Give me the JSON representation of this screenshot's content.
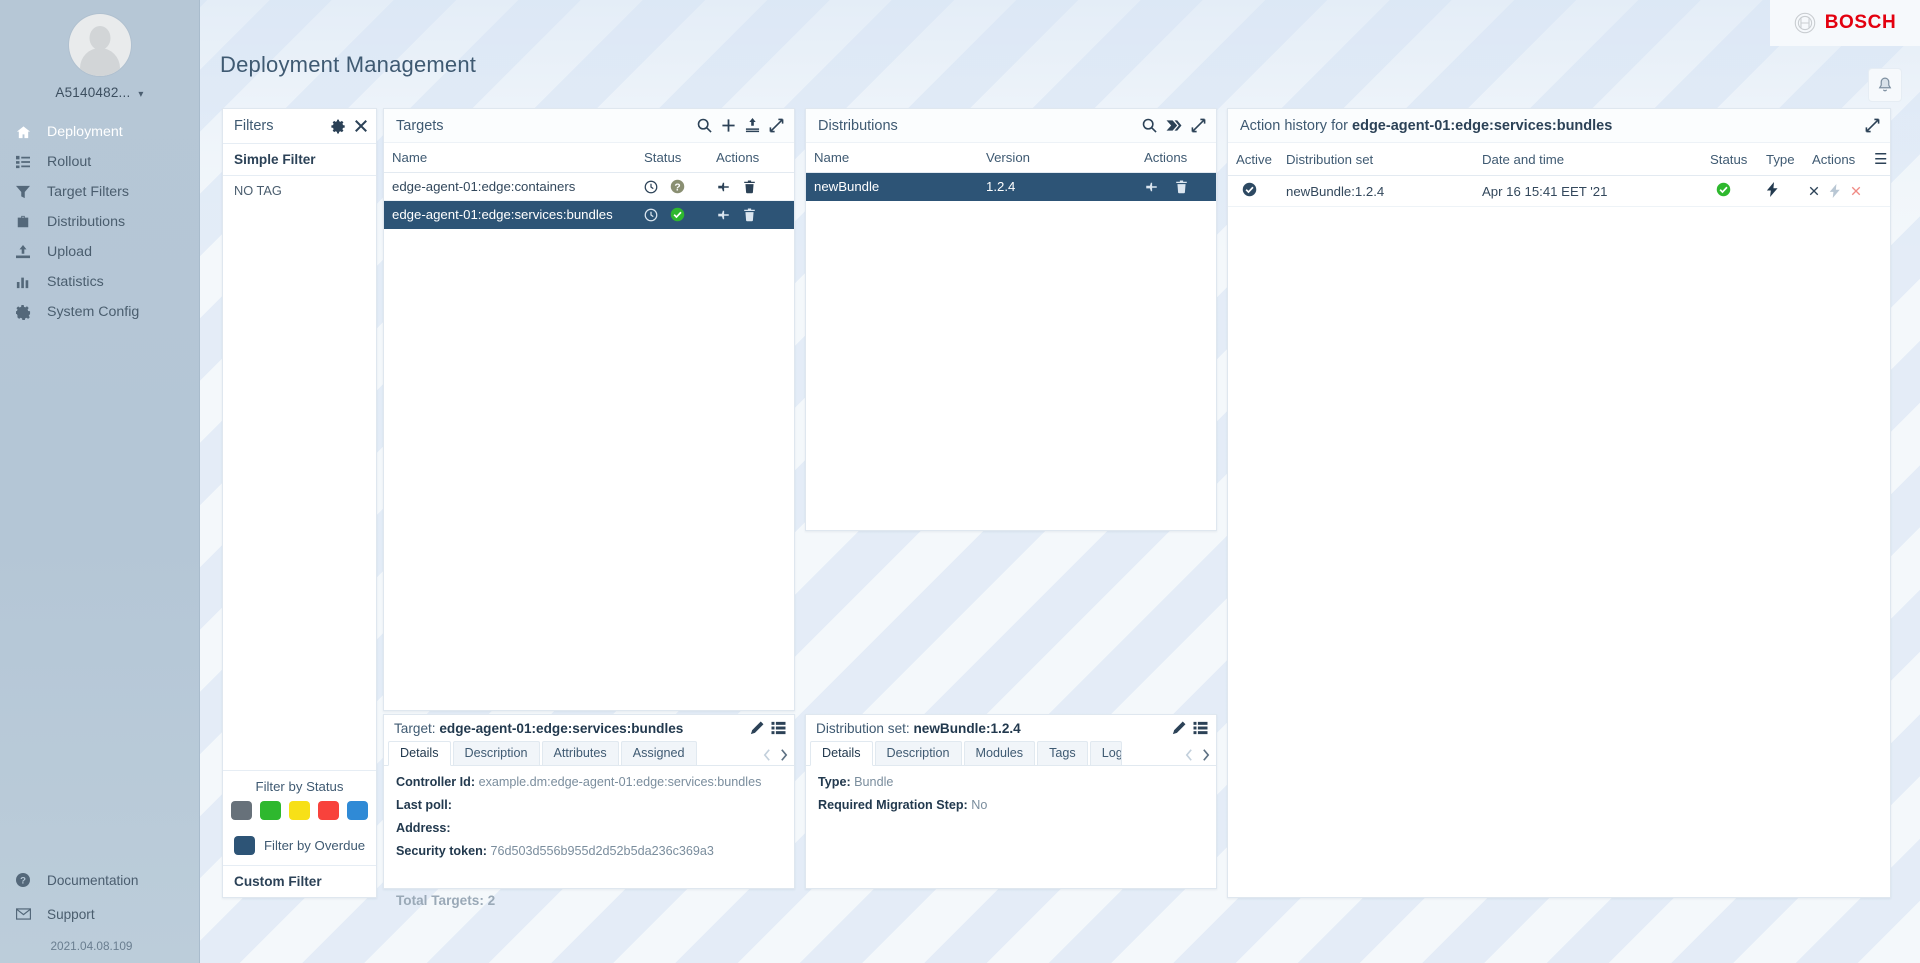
{
  "brand": {
    "name": "BOSCH",
    "logo_icon": "bosch-mark-icon"
  },
  "header": {
    "title": "Deployment Management",
    "bell_icon": "notification-bell-icon"
  },
  "sidebar": {
    "user": {
      "name": "A5140482...",
      "chevron": "∨",
      "avatar_icon": "user-avatar-icon"
    },
    "items": [
      {
        "label": "Deployment",
        "icon": "home-icon",
        "active": true
      },
      {
        "label": "Rollout",
        "icon": "list-icon",
        "active": false
      },
      {
        "label": "Target Filters",
        "icon": "funnel-icon",
        "active": false
      },
      {
        "label": "Distributions",
        "icon": "briefcase-icon",
        "active": false
      },
      {
        "label": "Upload",
        "icon": "upload-icon",
        "active": false
      },
      {
        "label": "Statistics",
        "icon": "bar-chart-icon",
        "active": false
      },
      {
        "label": "System Config",
        "icon": "gear-icon",
        "active": false
      }
    ],
    "bottom_items": [
      {
        "label": "Documentation",
        "icon": "question-circle-icon"
      },
      {
        "label": "Support",
        "icon": "envelope-icon"
      }
    ],
    "version": "2021.04.08.109"
  },
  "filters": {
    "title": "Filters",
    "gear_icon": "gear-icon",
    "close_icon": "close-icon",
    "simple_filter_label": "Simple Filter",
    "no_tag_label": "NO TAG",
    "status_label": "Filter by Status",
    "status_colors": [
      "#67717a",
      "#2eb82e",
      "#f7e017",
      "#f8423c",
      "#2f8ad6"
    ],
    "overdue_label": "Filter by Overdue",
    "overdue_color": "#2d5476",
    "custom_filter_label": "Custom Filter"
  },
  "targets": {
    "title": "Targets",
    "actions": [
      "search-icon",
      "plus-icon",
      "upload-icon",
      "maximize-icon"
    ],
    "columns": [
      "Name",
      "Status",
      "Actions"
    ],
    "rows": [
      {
        "name": "edge-agent-01:edge:containers",
        "status_icons": [
          "clock-icon",
          "question-circle-icon"
        ],
        "status_color": "#8a8f72",
        "action_icons": [
          "pin-icon",
          "trash-icon"
        ],
        "selected": false
      },
      {
        "name": "edge-agent-01:edge:services:bundles",
        "status_icons": [
          "clock-icon",
          "check-circle-icon"
        ],
        "status_color": "#2eb82e",
        "action_icons": [
          "pin-icon",
          "trash-icon"
        ],
        "selected": true
      }
    ],
    "total_label": "Total Targets: 2"
  },
  "distributions": {
    "title": "Distributions",
    "actions": [
      "search-icon",
      "tag-icon",
      "maximize-icon"
    ],
    "columns": [
      "Name",
      "Version",
      "Actions"
    ],
    "rows": [
      {
        "name": "newBundle",
        "version": "1.2.4",
        "action_icons": [
          "pin-icon",
          "trash-icon"
        ],
        "selected": true
      }
    ]
  },
  "action_history": {
    "title_prefix": "Action history for",
    "title_target": "edge-agent-01:edge:services:bundles",
    "maximize_icon": "maximize-icon",
    "columns": [
      "Active",
      "Distribution set",
      "Date and time",
      "Status",
      "Type",
      "Actions",
      "☰"
    ],
    "rows": [
      {
        "active_icon": "active-check-icon",
        "distribution_set": "newBundle:1.2.4",
        "date_time": "Apr 16 15:41 EET '21",
        "status_icon": "check-circle-icon",
        "type_icon": "bolt-icon",
        "action_icons": [
          "cancel-x-icon",
          "force-bolt-icon",
          "force-quit-x-icon"
        ]
      }
    ]
  },
  "target_detail": {
    "label": "Target:",
    "value": "edge-agent-01:edge:services:bundles",
    "edit_icon": "pencil-icon",
    "list_icon": "list-icon",
    "tabs": [
      "Details",
      "Description",
      "Attributes",
      "Assigned"
    ],
    "active_tab": "Details",
    "prev_icon": "chevron-left-icon",
    "next_icon": "chevron-right-icon",
    "fields": [
      {
        "key": "Controller Id:",
        "value": "example.dm:edge-agent-01:edge:services:bundles"
      },
      {
        "key": "Last poll:",
        "value": ""
      },
      {
        "key": "Address:",
        "value": ""
      },
      {
        "key": "Security token:",
        "value": "76d503d556b955d2d52b5da236c369a3"
      }
    ]
  },
  "distribution_detail": {
    "label": "Distribution set:",
    "value": "newBundle:1.2.4",
    "edit_icon": "pencil-icon",
    "list_icon": "list-icon",
    "tabs": [
      "Details",
      "Description",
      "Modules",
      "Tags",
      "Logs"
    ],
    "active_tab": "Details",
    "prev_icon": "chevron-left-icon",
    "next_icon": "chevron-right-icon",
    "fields": [
      {
        "key": "Type:",
        "value": "Bundle"
      },
      {
        "key": "Required Migration Step:",
        "value": "No"
      }
    ]
  }
}
